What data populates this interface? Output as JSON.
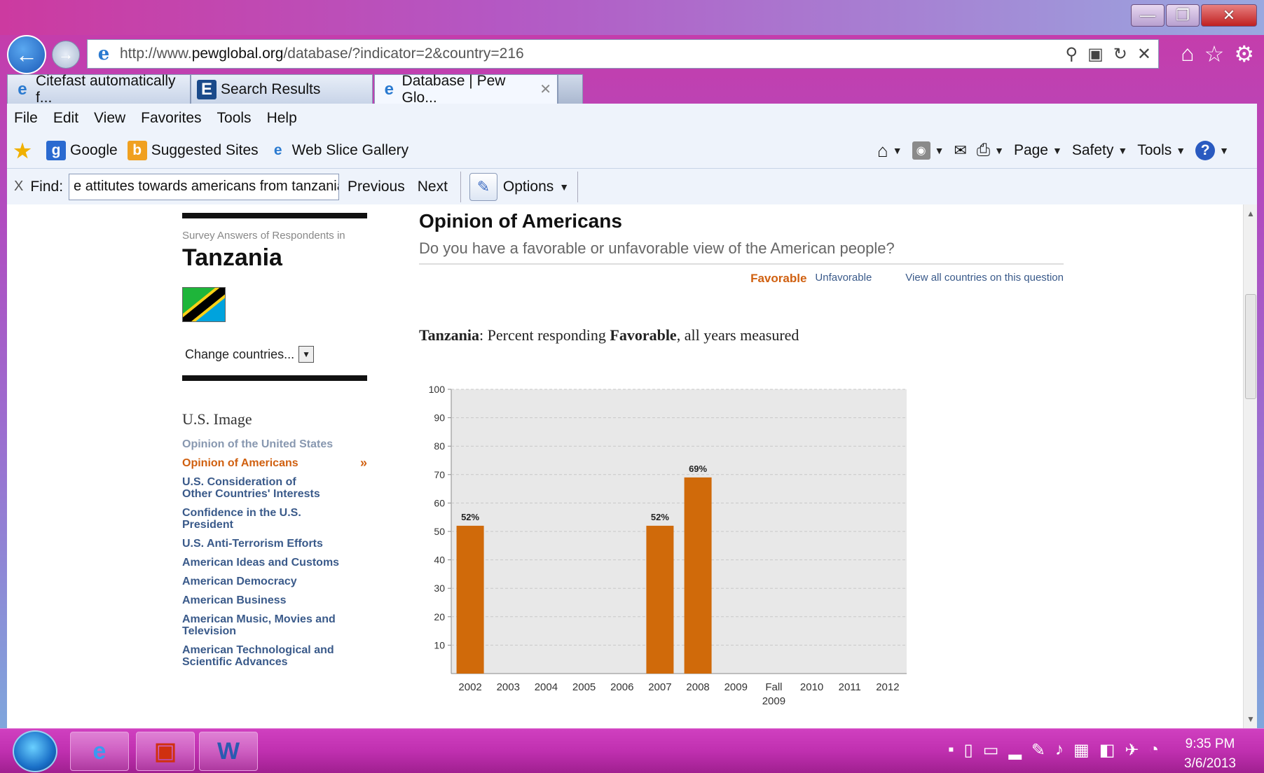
{
  "browser": {
    "url_prefix": "http://www.",
    "url_domain": "pewglobal.org",
    "url_path": "/database/?indicator=2&country=216",
    "tabs": [
      {
        "label": "Citefast automatically f...",
        "icon": "ie-icon"
      },
      {
        "label": "Search Results",
        "icon": "e-icon"
      },
      {
        "label": "Database | Pew Glo...",
        "icon": "ie-icon",
        "active": true
      }
    ],
    "menu": [
      "File",
      "Edit",
      "View",
      "Favorites",
      "Tools",
      "Help"
    ],
    "favorites": [
      "Google",
      "Suggested Sites",
      "Web Slice Gallery"
    ],
    "commands": [
      "Page",
      "Safety",
      "Tools"
    ],
    "find": {
      "label": "Find:",
      "value": "e attitutes towards americans from tanzania",
      "previous": "Previous",
      "next": "Next",
      "options": "Options"
    }
  },
  "sidebar": {
    "survey_caption": "Survey Answers of Respondents in",
    "country": "Tanzania",
    "change_label": "Change countries...",
    "section_heading": "U.S. Image",
    "links": [
      {
        "label": "Opinion of the United States",
        "state": "muted"
      },
      {
        "label": "Opinion of Americans",
        "state": "active"
      },
      {
        "label": "U.S. Consideration of Other Countries' Interests",
        "state": "normal"
      },
      {
        "label": "Confidence in the U.S. President",
        "state": "normal"
      },
      {
        "label": "U.S. Anti-Terrorism Efforts",
        "state": "normal"
      },
      {
        "label": "American Ideas and Customs",
        "state": "normal"
      },
      {
        "label": "American Democracy",
        "state": "normal"
      },
      {
        "label": "American Business",
        "state": "normal"
      },
      {
        "label": "American Music, Movies and Television",
        "state": "normal"
      },
      {
        "label": "American Technological and Scientific Advances",
        "state": "normal"
      }
    ]
  },
  "main": {
    "title": "Opinion of Americans",
    "question": "Do you have a favorable or unfavorable view of the American people?",
    "toggle_favorable": "Favorable",
    "toggle_unfavorable": "Unfavorable",
    "view_all": "View all countries on this question",
    "chart_heading_country": "Tanzania",
    "chart_heading_mid": ": Percent responding ",
    "chart_heading_answer": "Favorable",
    "chart_heading_tail": ", all years measured"
  },
  "chart_data": {
    "type": "bar",
    "categories": [
      "2002",
      "2003",
      "2004",
      "2005",
      "2006",
      "2007",
      "2008",
      "2009",
      "Fall 2009",
      "2010",
      "2011",
      "2012"
    ],
    "values": [
      52,
      null,
      null,
      null,
      null,
      52,
      69,
      null,
      null,
      null,
      null,
      null
    ],
    "data_labels": [
      "52%",
      "",
      "",
      "",
      "",
      "52%",
      "69%",
      "",
      "",
      "",
      "",
      ""
    ],
    "yticks": [
      10,
      20,
      30,
      40,
      50,
      60,
      70,
      80,
      90,
      100
    ],
    "ylim": [
      0,
      100
    ],
    "bar_color": "#d06a0a",
    "plot_bg": "#e8e8e8",
    "grid": true
  },
  "taskbar": {
    "time": "9:35 PM",
    "date": "3/6/2013"
  },
  "colors": {
    "accent_orange": "#d06010",
    "link_blue": "#3a5a8a"
  }
}
